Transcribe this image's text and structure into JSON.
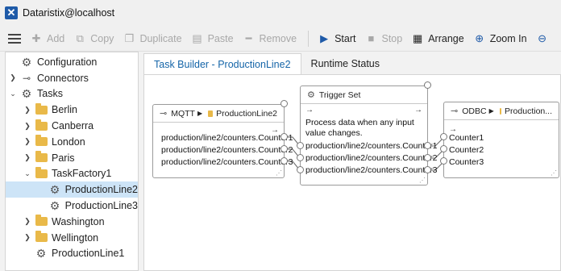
{
  "window": {
    "title": "Dataristix@localhost"
  },
  "toolbar": {
    "add": "Add",
    "copy": "Copy",
    "duplicate": "Duplicate",
    "paste": "Paste",
    "remove": "Remove",
    "start": "Start",
    "stop": "Stop",
    "arrange": "Arrange",
    "zoom_in": "Zoom In"
  },
  "tree": {
    "items": [
      {
        "label": "Configuration"
      },
      {
        "label": "Connectors"
      },
      {
        "label": "Tasks"
      },
      {
        "label": "Berlin"
      },
      {
        "label": "Canberra"
      },
      {
        "label": "London"
      },
      {
        "label": "Paris"
      },
      {
        "label": "TaskFactory1"
      },
      {
        "label": "ProductionLine2"
      },
      {
        "label": "ProductionLine3"
      },
      {
        "label": "Washington"
      },
      {
        "label": "Wellington"
      },
      {
        "label": "ProductionLine1"
      }
    ]
  },
  "tabs": [
    {
      "label": "Task Builder - ProductionLine2"
    },
    {
      "label": "Runtime Status"
    }
  ],
  "nodes": {
    "mqtt": {
      "type": "MQTT",
      "name": "ProductionLine2",
      "arrow": "→",
      "outputs": [
        "production/line2/counters.Counter1",
        "production/line2/counters.Counter2",
        "production/line2/counters.Counter3"
      ]
    },
    "trigger": {
      "title": "Trigger Set",
      "description": "Process data when any input value changes.",
      "arrow_in": "→",
      "arrow_out": "→",
      "items": [
        "production/line2/counters.Counter1",
        "production/line2/counters.Counter2",
        "production/line2/counters.Counter3"
      ]
    },
    "odbc": {
      "type": "ODBC",
      "name": "Production...",
      "arrow": "→",
      "inputs": [
        "Counter1",
        "Counter2",
        "Counter3"
      ]
    }
  }
}
